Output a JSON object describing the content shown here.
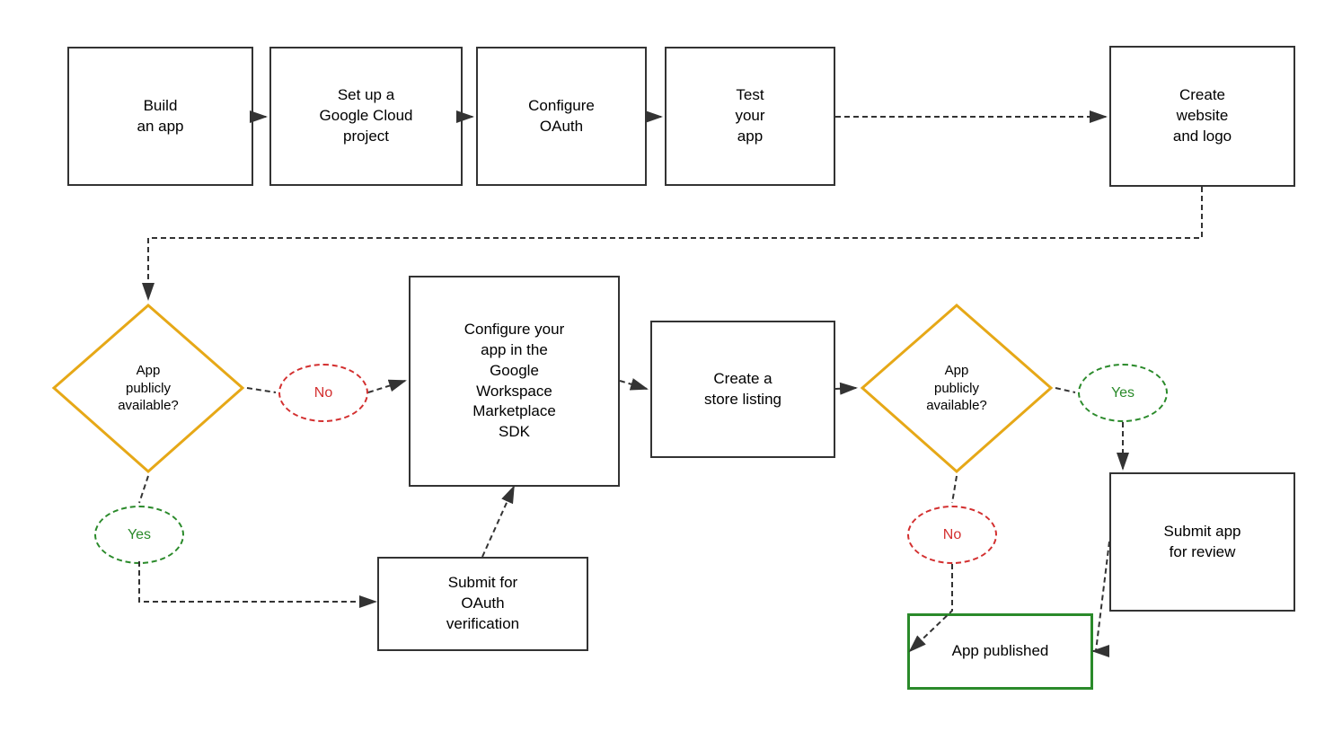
{
  "boxes": {
    "build_app": {
      "label": "Build\nan app"
    },
    "google_cloud": {
      "label": "Set up a\nGoogle Cloud\nproject"
    },
    "configure_oauth": {
      "label": "Configure\nOAuth"
    },
    "test_app": {
      "label": "Test\nyour\napp"
    },
    "create_website": {
      "label": "Create\nwebsite\nand logo"
    },
    "configure_workspace": {
      "label": "Configure your\napp in the\nGoogle\nWorkspace\nMarketplace\nSDK"
    },
    "create_store": {
      "label": "Create a\nstore listing"
    },
    "submit_oauth": {
      "label": "Submit for\nOAuth\nverification"
    },
    "submit_review": {
      "label": "Submit app\nfor review"
    },
    "app_published": {
      "label": "App published"
    }
  },
  "diamonds": {
    "app_available_1": {
      "label": "App\npublicly\navailable?"
    },
    "app_available_2": {
      "label": "App\npublicly\navailable?"
    }
  },
  "ovals": {
    "no_1": {
      "label": "No"
    },
    "yes_1": {
      "label": "Yes"
    },
    "no_2": {
      "label": "No"
    },
    "yes_2": {
      "label": "Yes"
    }
  },
  "colors": {
    "diamond_stroke": "#E6A817",
    "box_stroke": "#333333",
    "green_stroke": "#2a8a2a",
    "red_oval": "#d32f2f",
    "green_oval": "#2a8a2a",
    "arrow": "#333333"
  }
}
